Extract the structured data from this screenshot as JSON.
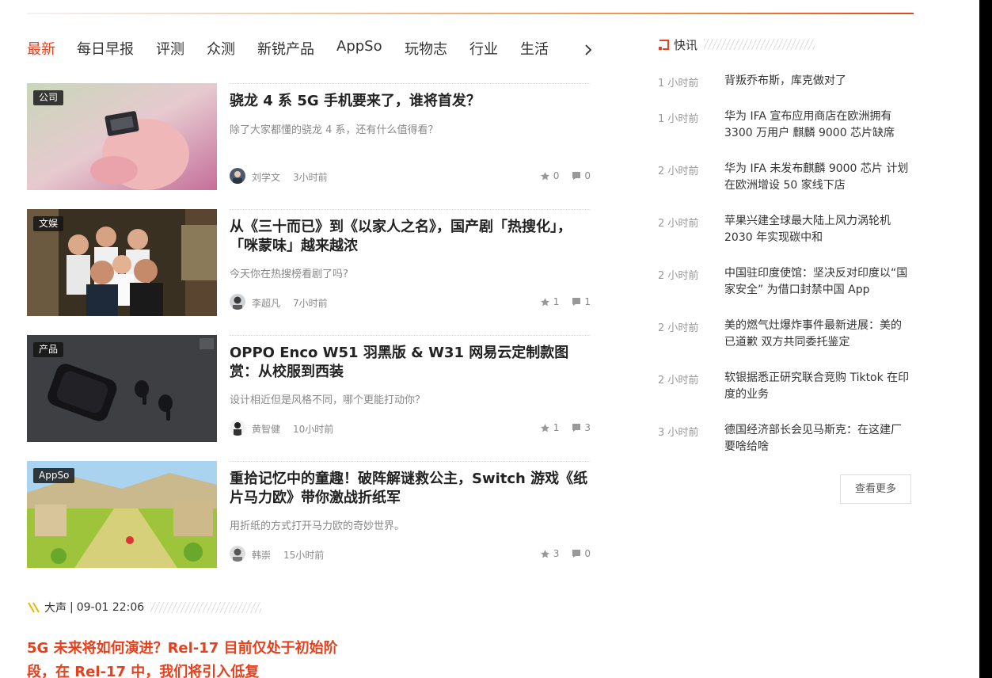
{
  "tabs": [
    "最新",
    "每日早报",
    "评测",
    "众测",
    "新锐产品",
    "AppSo",
    "玩物志",
    "行业",
    "生活"
  ],
  "colors": {
    "accent": "#e8401c"
  },
  "articles": [
    {
      "tag": "公司",
      "title": "骁龙 4 系 5G 手机要来了，谁将首发？",
      "desc": "除了大家都懂的骁龙 4 系，还有什么值得看？",
      "author": "刘学文",
      "time": "3小时前",
      "likes": "0",
      "comments": "0"
    },
    {
      "tag": "文娱",
      "title": "从《三十而已》到《以家人之名》，国产剧「热搜化」，「咪蒙味」越来越浓",
      "desc": "今天你在热搜榜看剧了吗?",
      "author": "李超凡",
      "time": "7小时前",
      "likes": "1",
      "comments": "1"
    },
    {
      "tag": "产品",
      "title": "OPPO Enco W51 羽黑版 & W31 网易云定制款图赏：从校服到西装",
      "desc": "设计相近但是风格不同，哪个更能打动你？",
      "author": "黄智健",
      "time": "10小时前",
      "likes": "1",
      "comments": "3"
    },
    {
      "tag": "AppSo",
      "title": "重拾记忆中的童趣！破阵解谜救公主，Switch 游戏《纸片马力欧》带你激战折纸军",
      "desc": "用折纸的方式打开马力欧的奇妙世界。",
      "author": "韩崇",
      "time": "15小时前",
      "likes": "3",
      "comments": "0"
    }
  ],
  "dasheng": {
    "label": "大声",
    "datetime": "09-01 22:06",
    "title": "5G 未来将如何演进？Rel-17 目前仅处于初始阶段，在 Rel-17 中，我们将引入低复"
  },
  "flash": {
    "title": "快讯",
    "items": [
      {
        "time": "1 小时前",
        "text": "背叛乔布斯，库克做对了"
      },
      {
        "time": "1 小时前",
        "text": "华为 IFA 宣布应用商店在欧洲拥有 3300 万用户 麒麟 9000 芯片缺席"
      },
      {
        "time": "2 小时前",
        "text": "华为 IFA 未发布麒麟 9000 芯片 计划在欧洲增设 50 家线下店"
      },
      {
        "time": "2 小时前",
        "text": "苹果兴建全球最大陆上风力涡轮机 2030 年实现碳中和"
      },
      {
        "time": "2 小时前",
        "text": "中国驻印度使馆：坚决反对印度以“国家安全” 为借口封禁中国 App"
      },
      {
        "time": "2 小时前",
        "text": "美的燃气灶爆炸事件最新进展：美的已道歉 双方共同委托鉴定"
      },
      {
        "time": "2 小时前",
        "text": "软银据悉正研究联合竞购 Tiktok 在印度的业务"
      },
      {
        "time": "3 小时前",
        "text": "德国经济部长会见马斯克：在这建厂 要啥给啥"
      }
    ],
    "more": "查看更多"
  }
}
